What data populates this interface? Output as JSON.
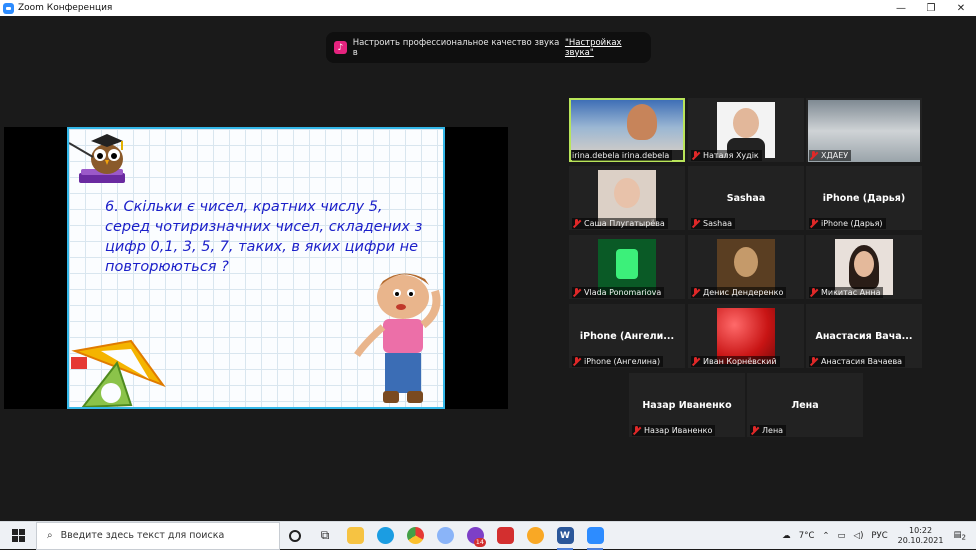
{
  "window": {
    "title": "Zoom Конференция",
    "minimize": "—",
    "maximize": "❐",
    "close": "✕"
  },
  "notice": {
    "text": "Настроить профессиональное качество звука в ",
    "link": "\"Настройках звука\""
  },
  "slide": {
    "task": "6. Скільки є чисел, кратних числу 5, серед чотиризначних чисел, складених з цифр 0,1, 3, 5, 7, таких, в яких цифри не повторюються ?"
  },
  "participants": [
    {
      "label": "irina.debela irina.debela",
      "name": "",
      "muted": false,
      "speaking": true
    },
    {
      "label": "Наталя Худік",
      "name": "",
      "muted": true
    },
    {
      "label": "ХДАЕУ",
      "name": "",
      "muted": true
    },
    {
      "label": "Саша Плугатырёва",
      "name": "",
      "muted": true
    },
    {
      "label": "Sashaa",
      "name": "Sashaa",
      "muted": true
    },
    {
      "label": "iPhone (Дарья)",
      "name": "iPhone (Дарья)",
      "muted": true
    },
    {
      "label": "Vlada Ponomariova",
      "name": "",
      "muted": true
    },
    {
      "label": "Денис Дендеренко",
      "name": "",
      "muted": true
    },
    {
      "label": "Микитас Анна",
      "name": "",
      "muted": true
    },
    {
      "label": "iPhone (Ангелина)",
      "name": "iPhone (Ангели...",
      "muted": true
    },
    {
      "label": "Иван Корнёвский",
      "name": "",
      "muted": true
    },
    {
      "label": "Анастасия Вачаева",
      "name": "Анастасия Вача...",
      "muted": true
    },
    {
      "label": "Назар Иваненко",
      "name": "Назар Иваненко",
      "muted": true
    },
    {
      "label": "Лена",
      "name": "Лена",
      "muted": true
    }
  ],
  "taskbar": {
    "search_placeholder": "Введите здесь текст для поиска",
    "badge": "14",
    "weather": "7°C",
    "lang": "РУС",
    "time": "10:22",
    "date": "20.10.2021",
    "notif": "2"
  }
}
